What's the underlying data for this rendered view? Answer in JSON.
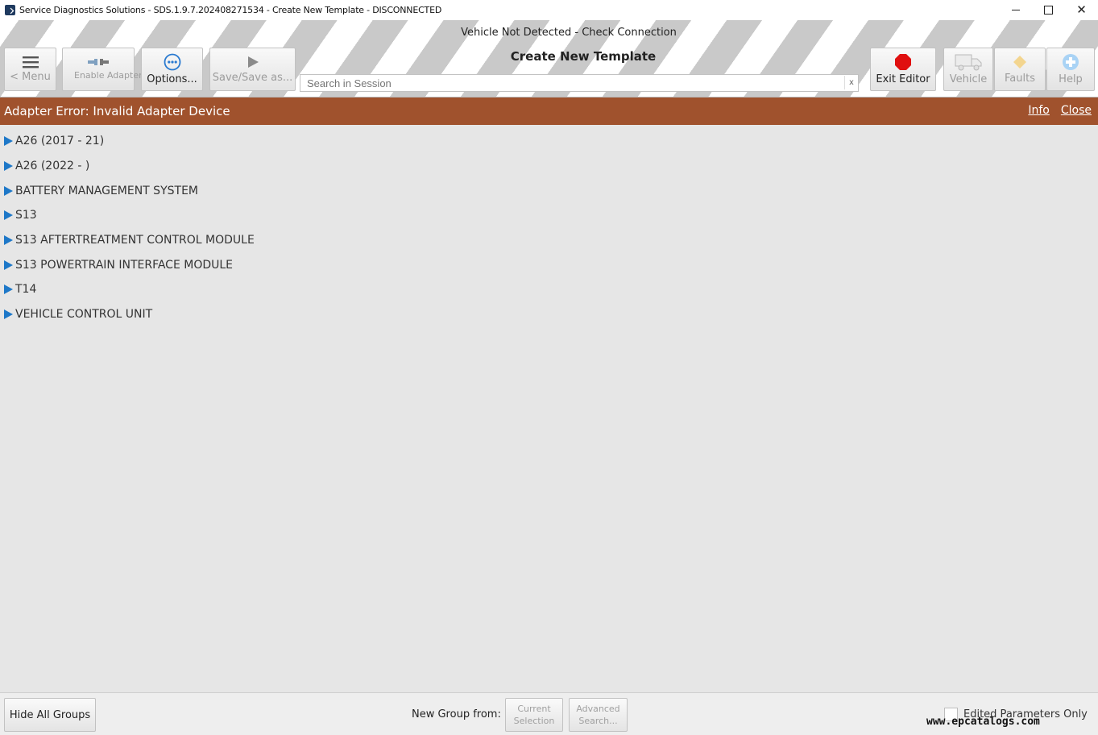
{
  "window": {
    "title": "Service Diagnostics Solutions - SDS.1.9.7.202408271534 - Create New Template - DISCONNECTED",
    "controls": {
      "minimize": "",
      "maximize": "",
      "close": "✕"
    }
  },
  "toolbar": {
    "status": "Vehicle Not Detected - Check Connection",
    "page_title": "Create New Template",
    "menu_label": "< Menu",
    "enable_adapter_label": "Enable Adapter",
    "options_label": "Options...",
    "save_label": "Save/Save as...",
    "search": {
      "placeholder": "Search in Session",
      "value": "",
      "clear": "x"
    },
    "exit_editor_label": "Exit Editor",
    "vehicle_label": "Vehicle",
    "faults_label": "Faults",
    "help_label": "Help"
  },
  "banner": {
    "message": "Adapter Error: Invalid Adapter Device",
    "info_link": "Info",
    "close_link": "Close",
    "color": "#a0522d"
  },
  "tree": {
    "items": [
      {
        "label": "A26 (2017 - 21)"
      },
      {
        "label": "A26 (2022 - )"
      },
      {
        "label": "BATTERY MANAGEMENT SYSTEM"
      },
      {
        "label": "S13"
      },
      {
        "label": "S13 AFTERTREATMENT CONTROL MODULE"
      },
      {
        "label": "S13 POWERTRAIN INTERFACE MODULE"
      },
      {
        "label": "T14"
      },
      {
        "label": "VEHICLE CONTROL UNIT"
      }
    ],
    "expander_color": "#1e78c8"
  },
  "bottombar": {
    "hide_groups_label": "Hide All Groups",
    "new_group_label": "New Group from:",
    "current_selection_label": "Current Selection",
    "advanced_search_label": "Advanced Search...",
    "edited_only_label": "Edited Parameters Only",
    "edited_only_checked": false
  },
  "watermark": "www.epcatalogs.com"
}
